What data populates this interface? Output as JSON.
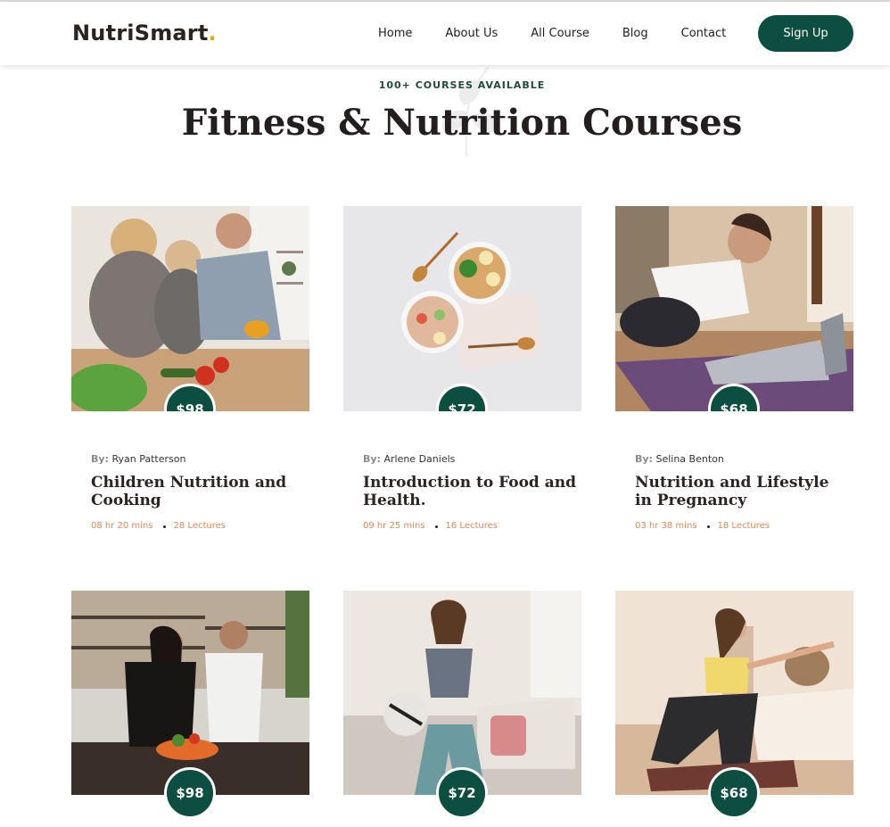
{
  "header": {
    "logo_text": "NutriSmart",
    "logo_dot": ".",
    "nav": [
      "Home",
      "About Us",
      "All Course",
      "Blog",
      "Contact"
    ],
    "signup_label": "Sign Up"
  },
  "section": {
    "eyebrow": "100+ COURSES AVAILABLE",
    "title": "Fitness & Nutrition Courses"
  },
  "courses": [
    {
      "price": "$98",
      "by_label": "By:",
      "author": "Ryan Patterson",
      "title": "Children Nutrition and Cooking",
      "duration": "08 hr 20 mins",
      "lectures": "28 Lectures",
      "image": "family-cooking-photo"
    },
    {
      "price": "$72",
      "by_label": "By:",
      "author": "Arlene Daniels",
      "title": "Introduction to Food and Health.",
      "duration": "09 hr 25 mins",
      "lectures": "16 Lectures",
      "image": "food-bowls-photo"
    },
    {
      "price": "$68",
      "by_label": "By:",
      "author": "Selina Benton",
      "title": "Nutrition and Lifestyle in Pregnancy",
      "duration": "03 hr 38 mins",
      "lectures": "18 Lectures",
      "image": "woman-laptop-yoga-photo"
    },
    {
      "price": "$98",
      "image": "couple-kitchen-photo"
    },
    {
      "price": "$72",
      "image": "woman-fitness-ball-photo"
    },
    {
      "price": "$68",
      "image": "woman-stretching-photo"
    }
  ],
  "colors": {
    "brand": "#0c4e3f",
    "accent": "#e0a800",
    "meta": "#d98a5a"
  }
}
